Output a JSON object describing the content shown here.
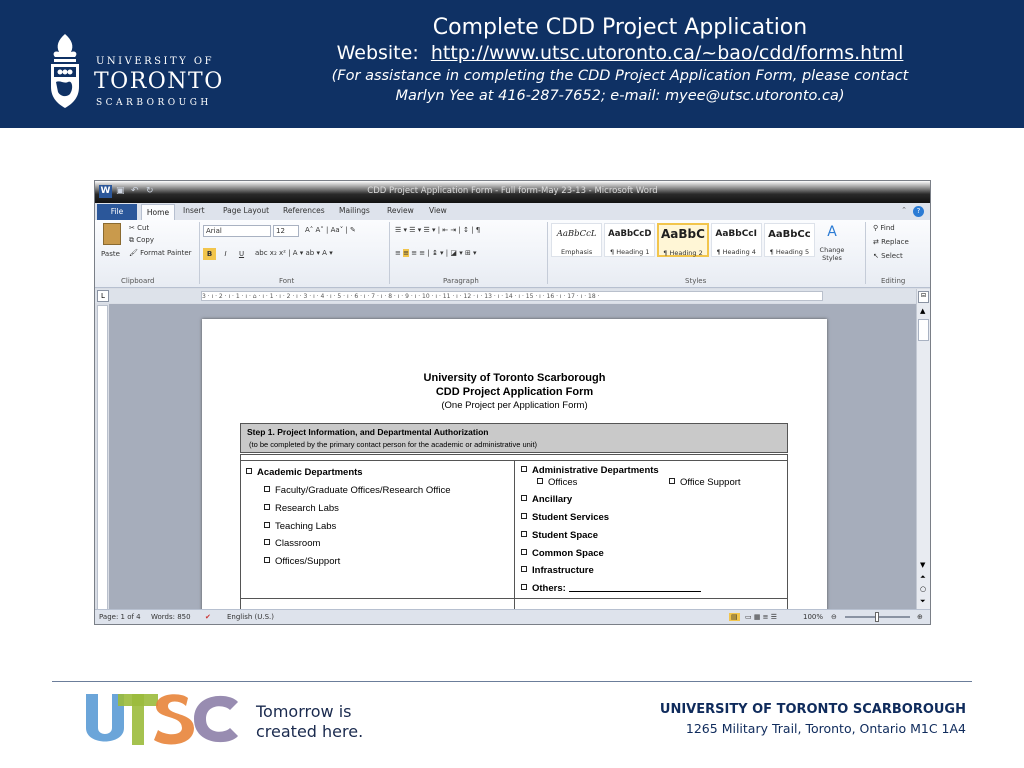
{
  "header": {
    "logo": {
      "line1": "UNIVERSITY OF",
      "line2": "TORONTO",
      "line3": "SCARBOROUGH"
    },
    "title": "Complete CDD Project Application",
    "website_label": "Website:",
    "website_url": "http://www.utsc.utoronto.ca/~bao/cdd/forms.html",
    "note_line1": "(For assistance in completing the CDD Project Application Form, please contact",
    "note_line2": "Marlyn Yee at 416-287-7652; e-mail:  myee@utsc.utoronto.ca)"
  },
  "word": {
    "window_title": "CDD Project Application Form - Full form-May 23-13  -  Microsoft Word",
    "app_icon": "W",
    "tabs": {
      "file": "File",
      "home": "Home",
      "insert": "Insert",
      "page_layout": "Page Layout",
      "references": "References",
      "mailings": "Mailings",
      "review": "Review",
      "view": "View"
    },
    "clipboard": {
      "paste": "Paste",
      "cut": "Cut",
      "copy": "Copy",
      "format_painter": "Format Painter",
      "label": "Clipboard"
    },
    "font": {
      "name": "Arial",
      "size": "12",
      "label": "Font",
      "bold": "B",
      "italic": "I",
      "underline": "U"
    },
    "paragraph": {
      "label": "Paragraph"
    },
    "styles": {
      "label": "Styles",
      "items": [
        {
          "sample": "AaBbCcL",
          "name": "Emphasis"
        },
        {
          "sample": "AaBbCcD",
          "name": "¶ Heading 1"
        },
        {
          "sample": "AaBbC",
          "name": "¶ Heading 2"
        },
        {
          "sample": "AaBbCcI",
          "name": "¶ Heading 4"
        },
        {
          "sample": "AaBbCc",
          "name": "¶ Heading 5"
        }
      ],
      "change_styles": "Change Styles"
    },
    "editing": {
      "find": "Find",
      "replace": "Replace",
      "select": "Select",
      "label": "Editing"
    },
    "ruler_text": "3 · ı · 2 · ı · 1 · ı · ⌂ · ı · 1 · ı · 2 · ı · 3 · ı · 4 · ı · 5 · ı · 6 · ı · 7 · ı · 8 · ı · 9 · ı · 10 · ı · 11 · ı · 12 · ı · 13 · ı · 14 · ı · 15 · ı · 16 · ı · 17 · ı · 18 ·",
    "tab_selector": "L",
    "status": {
      "page": "Page: 1 of 4",
      "words": "Words: 850",
      "language": "English (U.S.)",
      "zoom": "100%"
    }
  },
  "document": {
    "title1": "University of Toronto Scarborough",
    "title2": "CDD Project Application  Form",
    "title3": "(One Project per Application Form)",
    "step_heading": "Step 1.  Project Information, and Departmental Authorization",
    "step_sub": "(to be completed by the primary contact person  for the academic or administrative unit)",
    "left": {
      "heading": "Academic Departments",
      "items": [
        "Faculty/Graduate Offices/Research Office",
        "Research Labs",
        "Teaching Labs",
        "Classroom",
        "Offices/Support"
      ]
    },
    "right": {
      "heading": "Administrative Departments",
      "sub1": "Offices",
      "sub2": "Office Support",
      "items": [
        "Ancillary",
        "Student Services",
        "Student Space",
        "Common Space",
        "Infrastructure",
        "Others:"
      ]
    }
  },
  "footer": {
    "logo_text": "UTSC",
    "tagline1": "Tomorrow is",
    "tagline2": "created here.",
    "org": "UNIVERSITY OF TORONTO SCARBOROUGH",
    "address": "1265 Military Trail, Toronto, Ontario  M1C 1A4"
  },
  "colors": {
    "header_bg": "#0f3164",
    "word_accent": "#2b579a",
    "utsc_blue": "#5b9bd5",
    "utsc_green": "#9bbb3c",
    "utsc_orange": "#e8843a",
    "utsc_purple": "#8d7fa8"
  }
}
